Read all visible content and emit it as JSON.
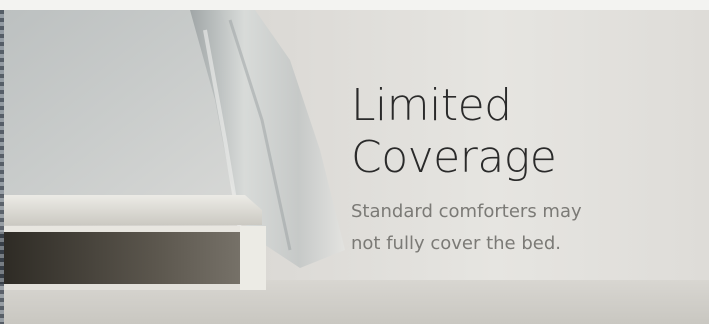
{
  "caption": {
    "title_line1": "Limited",
    "title_line2": "Coverage",
    "subtitle_line1": "Standard comforters may",
    "subtitle_line2": "not fully cover the bed."
  },
  "colors": {
    "background": "#dcdad6",
    "title": "#2a2a2a",
    "subtitle": "#7b7a76",
    "mattress_base": "#2f2b24"
  }
}
